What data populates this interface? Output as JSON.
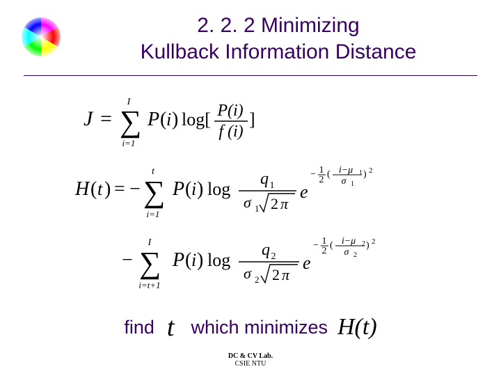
{
  "title": {
    "line1": "2. 2. 2 Minimizing",
    "line2": "Kullback Information Distance"
  },
  "formulas": {
    "J": "J = \\sum_{i=1}^{I} P(i) \\log[\\frac{P(i)}{f(i)}]",
    "H_line1": "H(t) = -\\sum_{i=1}^{t} P(i) \\log \\frac{q_1}{\\sigma_1 \\sqrt{2\\pi}} e^{-\\frac{1}{2}(\\frac{i-\\mu_1}{\\sigma_1})^2}",
    "H_line2": "- \\sum_{i=t+1}^{I} P(i) \\log \\frac{q_2}{\\sigma_2 \\sqrt{2\\pi}} e^{-\\frac{1}{2}(\\frac{i-\\mu_2}{\\sigma_2})^2}"
  },
  "bottom": {
    "find": "find",
    "t": "t",
    "which": "which minimizes",
    "Ht": "H(t)"
  },
  "footer": {
    "line1": "DC & CV Lab.",
    "line2": "CSIE NTU"
  },
  "icon": {
    "name": "color-wheel-icon"
  }
}
